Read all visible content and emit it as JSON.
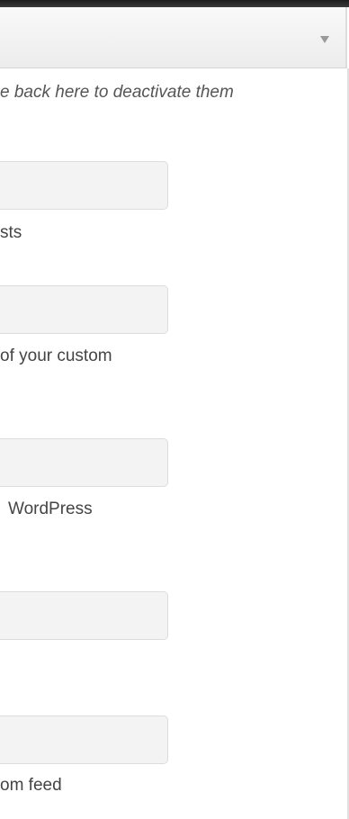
{
  "header": {
    "dropdown_arrow_icon": "triangle-down-icon"
  },
  "notice": {
    "text": "e back here to deactivate them"
  },
  "fields": [
    {
      "description": "sts"
    },
    {
      "description": "of your custom"
    },
    {
      "description": "WordPress"
    },
    {
      "description": ""
    },
    {
      "description": "om feed"
    }
  ]
}
